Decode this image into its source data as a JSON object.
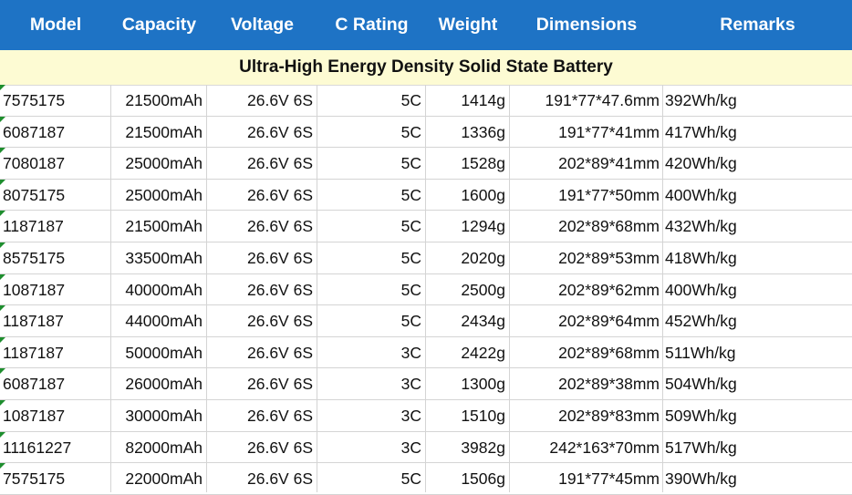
{
  "colors": {
    "header_bg": "#1e73c5",
    "header_text": "#ffffff",
    "band_bg": "#fdfbd3",
    "note_marker": "#1e8e2e"
  },
  "headers": [
    "Model",
    "Capacity",
    "Voltage",
    "C Rating",
    "Weight",
    "Dimensions",
    "Remarks"
  ],
  "section_title": "Ultra-High Energy Density Solid State Battery",
  "rows": [
    {
      "model": "7575175",
      "capacity": "21500mAh",
      "voltage": "26.6V 6S",
      "c_rating": "5C",
      "weight": "1414g",
      "dimensions": "191*77*47.6mm",
      "remarks": "392Wh/kg"
    },
    {
      "model": "6087187",
      "capacity": "21500mAh",
      "voltage": "26.6V 6S",
      "c_rating": "5C",
      "weight": "1336g",
      "dimensions": "191*77*41mm",
      "remarks": "417Wh/kg"
    },
    {
      "model": "7080187",
      "capacity": "25000mAh",
      "voltage": "26.6V 6S",
      "c_rating": "5C",
      "weight": "1528g",
      "dimensions": "202*89*41mm",
      "remarks": "420Wh/kg"
    },
    {
      "model": "8075175",
      "capacity": "25000mAh",
      "voltage": "26.6V 6S",
      "c_rating": "5C",
      "weight": "1600g",
      "dimensions": "191*77*50mm",
      "remarks": "400Wh/kg"
    },
    {
      "model": "1187187",
      "capacity": "21500mAh",
      "voltage": "26.6V 6S",
      "c_rating": "5C",
      "weight": "1294g",
      "dimensions": "202*89*68mm",
      "remarks": "432Wh/kg"
    },
    {
      "model": "8575175",
      "capacity": "33500mAh",
      "voltage": "26.6V 6S",
      "c_rating": "5C",
      "weight": "2020g",
      "dimensions": "202*89*53mm",
      "remarks": "418Wh/kg"
    },
    {
      "model": "1087187",
      "capacity": "40000mAh",
      "voltage": "26.6V 6S",
      "c_rating": "5C",
      "weight": "2500g",
      "dimensions": "202*89*62mm",
      "remarks": "400Wh/kg"
    },
    {
      "model": "1187187",
      "capacity": "44000mAh",
      "voltage": "26.6V 6S",
      "c_rating": "5C",
      "weight": "2434g",
      "dimensions": "202*89*64mm",
      "remarks": "452Wh/kg"
    },
    {
      "model": "1187187",
      "capacity": "50000mAh",
      "voltage": "26.6V 6S",
      "c_rating": "3C",
      "weight": "2422g",
      "dimensions": "202*89*68mm",
      "remarks": "511Wh/kg"
    },
    {
      "model": "6087187",
      "capacity": "26000mAh",
      "voltage": "26.6V 6S",
      "c_rating": "3C",
      "weight": "1300g",
      "dimensions": "202*89*38mm",
      "remarks": "504Wh/kg"
    },
    {
      "model": "1087187",
      "capacity": "30000mAh",
      "voltage": "26.6V 6S",
      "c_rating": "3C",
      "weight": "1510g",
      "dimensions": "202*89*83mm",
      "remarks": "509Wh/kg"
    },
    {
      "model": "11161227",
      "capacity": "82000mAh",
      "voltage": "26.6V 6S",
      "c_rating": "3C",
      "weight": "3982g",
      "dimensions": "242*163*70mm",
      "remarks": "517Wh/kg"
    },
    {
      "model": "7575175",
      "capacity": "22000mAh",
      "voltage": "26.6V 6S",
      "c_rating": "5C",
      "weight": "1506g",
      "dimensions": "191*77*45mm",
      "remarks": "390Wh/kg"
    }
  ]
}
